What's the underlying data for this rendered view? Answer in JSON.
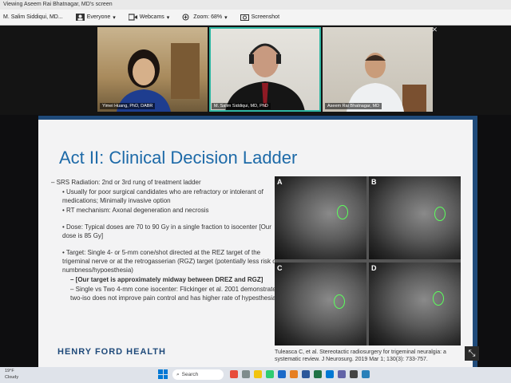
{
  "window": {
    "title": "Viewing Aseem Rai Bhatnagar, MD's screen"
  },
  "toolbar": {
    "participant": "M. Salim Siddiqui, MD...",
    "share_label": "Everyone",
    "webcams_label": "Webcams",
    "zoom_label": "Zoom: 68%",
    "screenshot_label": "Screenshot"
  },
  "videos": [
    {
      "name": "Yimei Huang, PhD, DABR"
    },
    {
      "name": "M. Salim Siddiqui, MD, PhD"
    },
    {
      "name": "Aseem Rai Bhatnagar, MD"
    }
  ],
  "slide": {
    "title": "Act II: Clinical Decision Ladder",
    "bullets": [
      "– SRS Radiation: 2nd or 3rd rung of treatment ladder",
      "• Usually for poor surgical candidates who are refractory or intolerant of medications; Minimally invasive option",
      "• RT mechanism: Axonal degeneration and necrosis",
      "• Dose: Typical doses are 70 to 90 Gy in a single fraction to isocenter [Our dose is 85 Gy]",
      "• Target: Single 4- or 5-mm cone/shot directed at the REZ target of the trigeminal nerve or at the retrogasserian (RGZ) target (potentially less risk of numbness/hypoesthesia)",
      "– [Our target is approximately midway between DREZ and RGZ]",
      "– Single vs Two 4-mm cone isocenter: Flickinger et al. 2001 demonstrates two-iso does not improve pain control and has higher rate of hypesthesia"
    ],
    "panel_labels": [
      "A",
      "B",
      "C",
      "D"
    ],
    "citation": "Tuleasca C, et al. Stereotactic radiosurgery for trigeminal neuralgia: a systematic review. J Neurosurg. 2019 Mar 1; 130(3): 733-757.",
    "logo": "HENRY FORD HEALTH"
  },
  "taskbar": {
    "weather_temp": "19°F",
    "weather_desc": "Cloudy",
    "search_label": "Search"
  },
  "colors": {
    "slide_title": "#1d6aa8",
    "brand_navy": "#1f4a7a",
    "mri_target": "#5cff5c"
  }
}
